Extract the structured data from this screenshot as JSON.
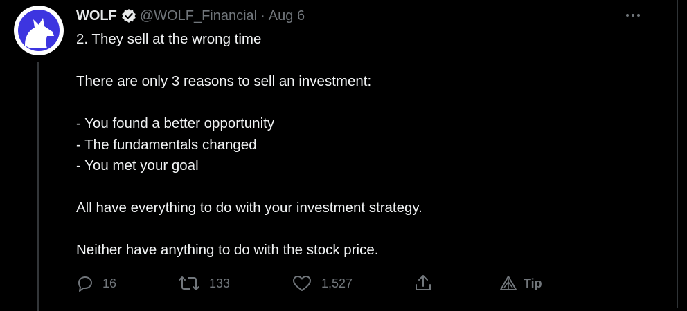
{
  "tweet": {
    "author_name": "WOLF",
    "handle": "@WOLF_Financial",
    "separator": "·",
    "date": "Aug 6",
    "lines": [
      "2. They sell at the wrong time",
      "",
      "There are only 3 reasons to sell an investment:",
      "",
      "- You found a better opportunity",
      "- The fundamentals changed",
      "- You met your goal",
      "",
      "All have everything to do with your investment strategy.",
      "",
      "Neither have anything to do with the stock price."
    ],
    "actions": {
      "reply_count": "16",
      "retweet_count": "133",
      "like_count": "1,527",
      "tip_label": "Tip"
    }
  },
  "icons": {
    "avatar": "wolf-logo",
    "verified": "verified-badge-icon",
    "more": "more-options-icon",
    "reply": "reply-icon",
    "retweet": "retweet-icon",
    "like": "heart-icon",
    "share": "share-icon",
    "tip": "tip-icon"
  },
  "colors": {
    "background": "#000000",
    "text": "#e7e9ea",
    "muted": "#71767b",
    "avatar_blue": "#3d35e0"
  }
}
